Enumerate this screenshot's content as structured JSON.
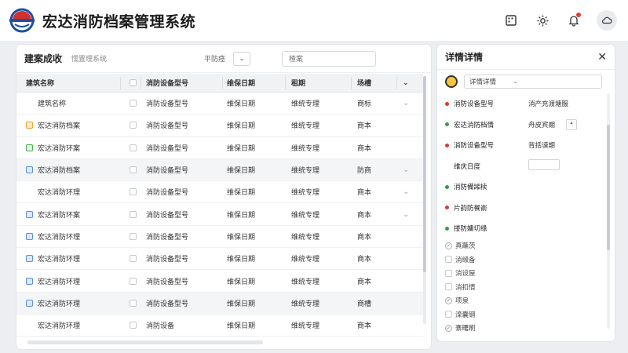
{
  "header": {
    "title": "宏达消防档案管理系统",
    "icons": [
      "grid-icon",
      "gear-icon",
      "bell-icon",
      "cloud-icon"
    ]
  },
  "main": {
    "title": "建案成收",
    "subtitle": "懦置理系统",
    "filter_label": "平防痉",
    "search_placeholder": "楂案",
    "columns": [
      "建筑名称",
      "消防设备型号",
      "维保日期",
      "租期",
      "场槽"
    ],
    "rows": [
      {
        "name": "建筑名称",
        "model": "消防设备型号",
        "date": "维保日期",
        "period": "维统专理",
        "field": "商标",
        "check": "plain",
        "hl": false
      },
      {
        "name": "宏达消防档案",
        "model": "消防设备型号",
        "date": "维保日期",
        "period": "维统专理",
        "field": "商本",
        "check": "orange",
        "hl": false
      },
      {
        "name": "宏达消防环案",
        "model": "消防设备型号",
        "date": "维保日期",
        "period": "维统专理",
        "field": "商本",
        "check": "green",
        "hl": false
      },
      {
        "name": "宏达消防档案",
        "model": "消防设备型号",
        "date": "维保日期",
        "period": "维统专理",
        "field": "防商",
        "check": "blue",
        "hl": true
      },
      {
        "name": "宏达消防环理",
        "model": "消防设备型号",
        "date": "维保日期",
        "period": "维统专理",
        "field": "商本",
        "check": "plain",
        "hl": false
      },
      {
        "name": "宏达消防环案",
        "model": "消防设备型号",
        "date": "维保日期",
        "period": "维统专理",
        "field": "商本",
        "check": "blue",
        "hl": false
      },
      {
        "name": "宏达消防环理",
        "model": "消防设备型号",
        "date": "维保日期",
        "period": "维统专理",
        "field": "商本",
        "check": "blue",
        "hl": false
      },
      {
        "name": "宏达消防环理",
        "model": "消防设备型号",
        "date": "维保日期",
        "period": "维统专理",
        "field": "商本",
        "check": "blue",
        "hl": false
      },
      {
        "name": "宏达消防环理",
        "model": "消防设备型号",
        "date": "维保日期",
        "period": "维统专理",
        "field": "商本",
        "check": "blue",
        "hl": false
      },
      {
        "name": "宏达消防环理",
        "model": "消防设备型号",
        "date": "维保日期",
        "period": "维统专理",
        "field": "商槽",
        "check": "blue",
        "hl": true
      },
      {
        "name": "宏达消防环理",
        "model": "消防设备",
        "date": "维保日期",
        "period": "维统专理",
        "field": "商本",
        "check": "plain",
        "hl": false
      }
    ]
  },
  "detail": {
    "title": "详情详情",
    "user_select": "详情详情",
    "items": [
      {
        "label": "消防设备型号",
        "value": "消产充渡塘服",
        "dot": "red"
      },
      {
        "label": "宏达消防档情",
        "value": "舟皮宾期",
        "dot": "green",
        "mini": "⁴"
      },
      {
        "label": "消防设备型号",
        "value": "背括谟期",
        "dot": "red"
      },
      {
        "label": "维庆日度",
        "value": "",
        "dot": "none",
        "input": true
      },
      {
        "label": "消防備嘂椟",
        "value": "",
        "dot": "green"
      },
      {
        "label": "片韵防餐嵛",
        "value": "",
        "dot": "red"
      },
      {
        "label": "搂防嫞切缘",
        "value": "",
        "dot": "green"
      }
    ],
    "checks": [
      {
        "label": "真蘸茨",
        "type": "circle"
      },
      {
        "label": "消缎备",
        "type": "box"
      },
      {
        "label": "消设屋",
        "type": "box"
      },
      {
        "label": "消扣情",
        "type": "box"
      },
      {
        "label": "项泉",
        "type": "circle"
      },
      {
        "label": "滦囊钢",
        "type": "box"
      },
      {
        "label": "寨曙刷",
        "type": "circle"
      }
    ]
  },
  "colors": {
    "accent_red": "#d93b3b",
    "accent_green": "#2e9e4a",
    "logo_blue": "#1f4fa0",
    "logo_red": "#d32f2f"
  }
}
